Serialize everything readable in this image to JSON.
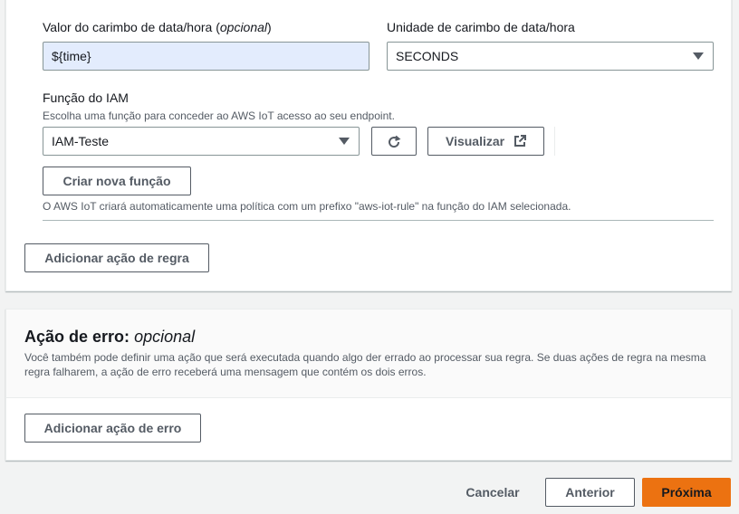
{
  "timestamp": {
    "value_label": "Valor do carimbo de data/hora",
    "value_label_optional": "opcional",
    "value": "${time}",
    "unit_label": "Unidade de carimbo de data/hora",
    "unit_selected": "SECONDS"
  },
  "iam": {
    "label": "Função do IAM",
    "description": "Escolha uma função para conceder ao AWS IoT acesso ao seu endpoint.",
    "selected_role": "IAM-Teste",
    "view_button": "Visualizar",
    "create_button": "Criar nova função",
    "policy_note": "O AWS IoT criará automaticamente uma política com um prefixo \"aws-iot-rule\" na função do IAM selecionada."
  },
  "add_rule_action_button": "Adicionar ação de regra",
  "error_action": {
    "title": "Ação de erro:",
    "title_optional": "opcional",
    "description_line1": "Você também pode definir uma ação que será executada quando algo der errado ao processar sua regra. Se duas ações de regra na mesma",
    "description_line2": "regra falharem, a ação de erro receberá uma mensagem que contém os dois erros.",
    "add_button": "Adicionar ação de erro"
  },
  "footer": {
    "cancel": "Cancelar",
    "previous": "Anterior",
    "next": "Próxima"
  }
}
